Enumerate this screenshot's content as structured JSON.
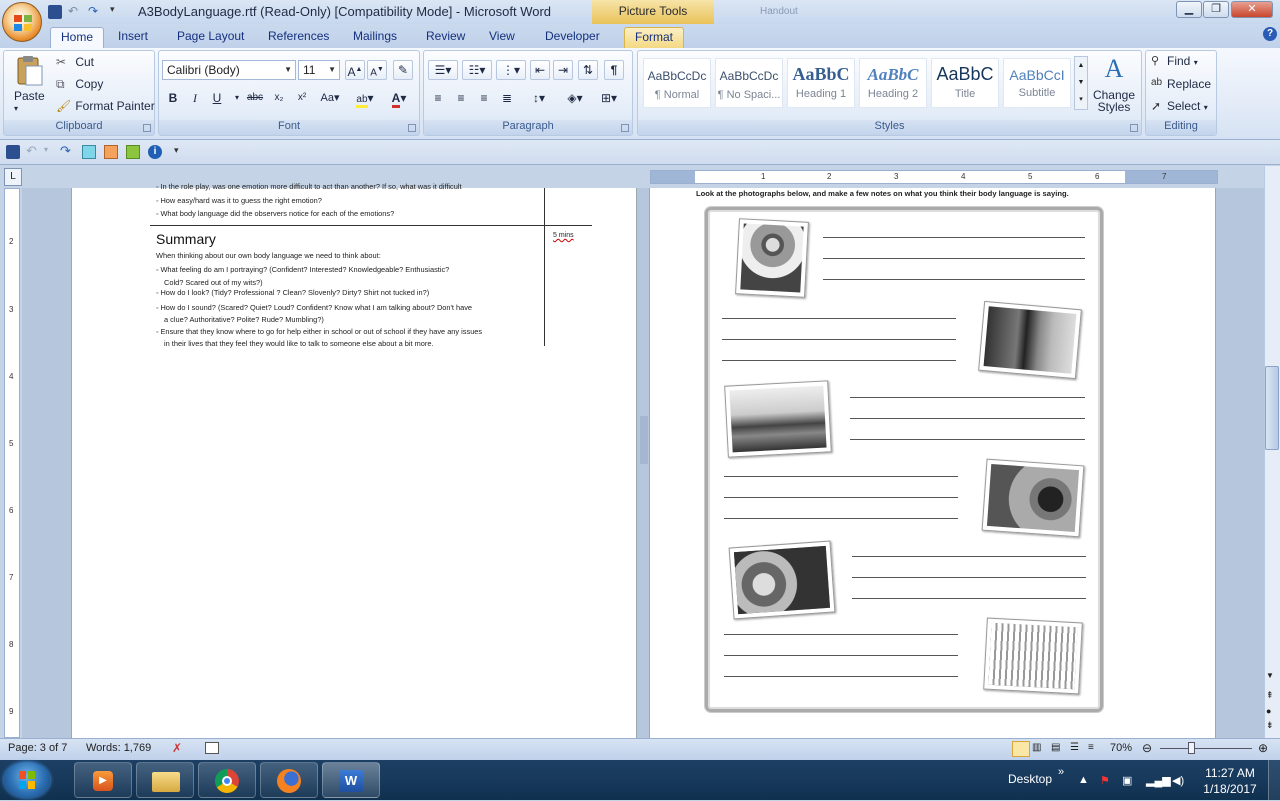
{
  "window": {
    "title": "A3BodyLanguage.rtf (Read-Only) [Compatibility Mode] - Microsoft Word",
    "contextual_tool": "Picture Tools",
    "background_title": "Handout"
  },
  "tabs": [
    "Home",
    "Insert",
    "Page Layout",
    "References",
    "Mailings",
    "Review",
    "View",
    "Developer"
  ],
  "contextual_tab": "Format",
  "clipboard": {
    "paste": "Paste",
    "cut": "Cut",
    "copy": "Copy",
    "format_painter": "Format Painter",
    "label": "Clipboard"
  },
  "font": {
    "name": "Calibri (Body)",
    "size": "11",
    "label": "Font"
  },
  "paragraph": {
    "label": "Paragraph"
  },
  "styles": {
    "label": "Styles",
    "items": [
      {
        "sample": "AaBbCcDc",
        "name": "¶ Normal"
      },
      {
        "sample": "AaBbCcDc",
        "name": "¶ No Spaci..."
      },
      {
        "sample": "AaBbC",
        "name": "Heading 1"
      },
      {
        "sample": "AaBbC",
        "name": "Heading 2"
      },
      {
        "sample": "AaBbC",
        "name": "Title"
      },
      {
        "sample": "AaBbCcI",
        "name": "Subtitle"
      }
    ],
    "change_styles": "Change Styles"
  },
  "editing": {
    "find": "Find",
    "replace": "Replace",
    "select": "Select",
    "label": "Editing"
  },
  "document": {
    "left_page": {
      "top_cut_bullet": "In the role play, was one emotion more difficult to act than another? If so, what was it difficult",
      "bullets_top": [
        "How easy/hard  was it to guess  the right emotion?",
        "What body  language  did  the observers  notice for each  of the emotions?"
      ],
      "summary_title": "Summary",
      "time_note": "5 mins",
      "intro": "When thinking  about  our own body  language  we need  to think about:",
      "bullets": [
        [
          "What feeling  do  am  I  portraying? (Confident? Interested? Knowledgeable? Enthusiastic?",
          "Cold? Scared  out of my wits?)"
        ],
        [
          "How do I look?  (Tidy? Professional ?  Clean?  Slovenly?  Dirty? Shirt not tucked  in?)"
        ],
        [
          "How do I sound? (Scared? Quiet? Loud? Confident? Know what I am talking about? Don't have",
          "a clue? Authoritative?   Polite?  Rude?  Mumbling?)"
        ],
        [
          "Ensure that they know where to go for help either in school or out of school if they have any issues",
          "in their lives  that  they  feel  they  would  like to talk to someone  else about  a bit more."
        ]
      ]
    },
    "right_page": {
      "instruction": "Look at the photographs below, and make a few notes on what you think their body language is saying."
    }
  },
  "status": {
    "page": "Page: 3 of 7",
    "words": "Words: 1,769",
    "zoom": "70%"
  },
  "taskbar": {
    "desktop": "Desktop",
    "time": "11:27 AM",
    "date": "1/18/2017"
  }
}
